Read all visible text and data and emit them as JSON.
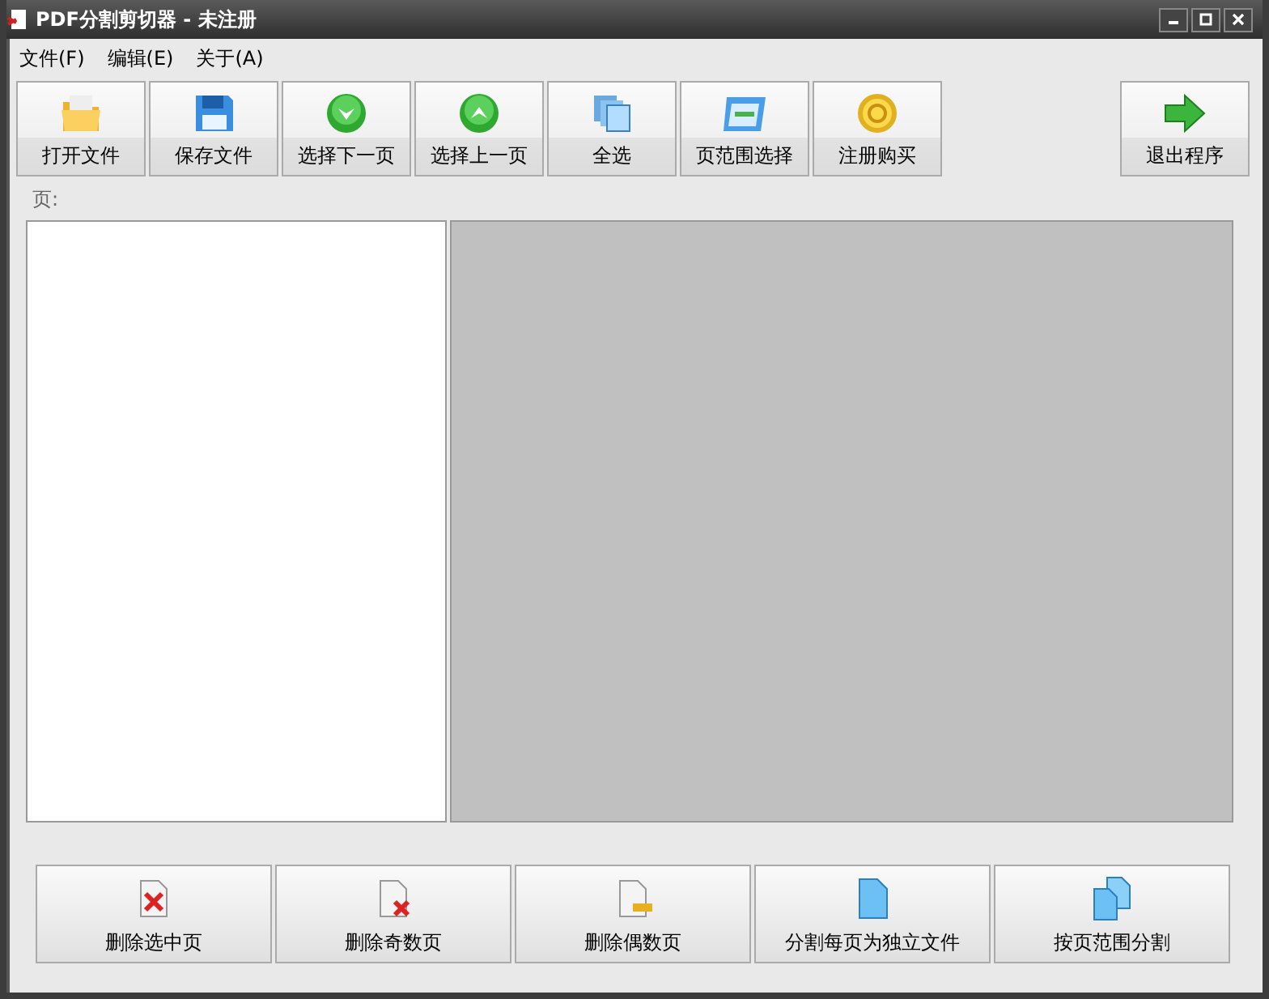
{
  "window": {
    "title": "PDF分割剪切器 - 未注册"
  },
  "menu": [
    "文件(F)",
    "编辑(E)",
    "关于(A)"
  ],
  "toolbar": [
    {
      "label": "打开文件",
      "kind": "folder"
    },
    {
      "label": "保存文件",
      "kind": "disk"
    },
    {
      "label": "选择下一页",
      "kind": "down"
    },
    {
      "label": "选择上一页",
      "kind": "up"
    },
    {
      "label": "全选",
      "kind": "pages"
    },
    {
      "label": "页范围选择",
      "kind": "grid"
    },
    {
      "label": "注册购买",
      "kind": "coin"
    },
    {
      "label": "退出程序",
      "kind": "exit"
    }
  ],
  "pages_label": "页:",
  "actions": [
    {
      "label": "删除选中页",
      "kind": "delete"
    },
    {
      "label": "删除奇数页",
      "kind": "delete-small"
    },
    {
      "label": "删除偶数页",
      "kind": "minus"
    },
    {
      "label": "分割每页为独立文件",
      "kind": "doc"
    },
    {
      "label": "按页范围分割",
      "kind": "docs"
    }
  ]
}
